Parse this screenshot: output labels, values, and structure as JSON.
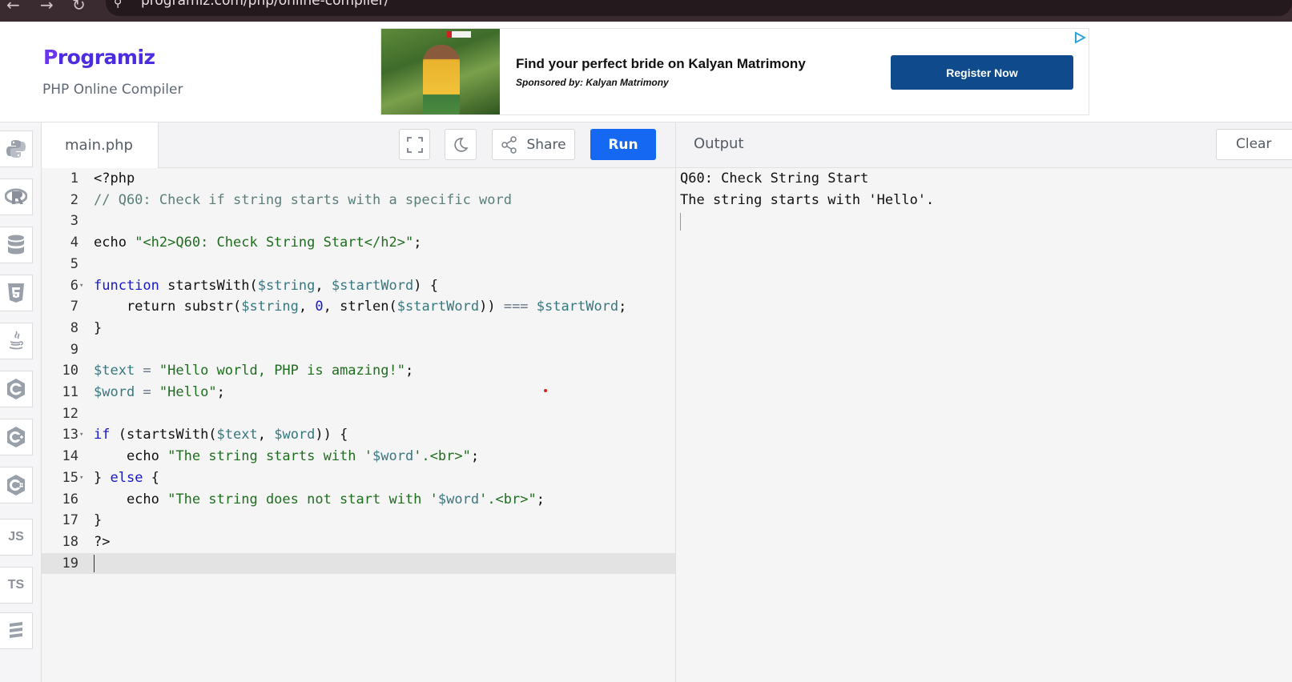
{
  "browser": {
    "url": "programiz.com/php/online-compiler/"
  },
  "header": {
    "logo_text": "rogramiz",
    "logo_mark": "P",
    "subtitle": "PHP Online Compiler"
  },
  "ad": {
    "title": "Find your perfect bride on Kalyan Matrimony",
    "sponsor": "Sponsored by: Kalyan Matrimony",
    "button_label": "Register Now",
    "button_color": "#0e4a8c"
  },
  "sidebar": {
    "languages": [
      {
        "name": "python-icon"
      },
      {
        "name": "r-icon"
      },
      {
        "name": "sql-icon"
      },
      {
        "name": "html5-icon"
      },
      {
        "name": "java-icon"
      },
      {
        "name": "c-icon"
      },
      {
        "name": "cpp-icon"
      },
      {
        "name": "csharp-icon"
      },
      {
        "name": "js-icon",
        "label": "JS"
      },
      {
        "name": "ts-icon",
        "label": "TS"
      },
      {
        "name": "go-icon"
      }
    ]
  },
  "editor": {
    "filename": "main.php",
    "share_label": "Share",
    "run_label": "Run",
    "run_color": "#1468f2",
    "active_line": 19,
    "line_numbers": [
      "1",
      "2",
      "3",
      "4",
      "5",
      "6",
      "7",
      "8",
      "9",
      "10",
      "11",
      "12",
      "13",
      "14",
      "15",
      "16",
      "17",
      "18",
      "19"
    ],
    "fold_lines": [
      6,
      13,
      15
    ]
  },
  "output": {
    "title": "Output",
    "clear_label": "Clear",
    "lines": [
      "Q60: Check String Start",
      "The string starts with 'Hello'."
    ]
  },
  "code": {
    "l1": "<?php",
    "l2": "// Q60: Check if string starts with a specific word",
    "l4_kw": "echo ",
    "l4_str": "\"<h2>Q60: Check String Start</h2>\"",
    "l4_end": ";",
    "l6_kw": "function",
    "l6_name": " startsWith(",
    "l6_v1": "$string",
    "l6_c": ", ",
    "l6_v2": "$startWord",
    "l6_end": ") {",
    "l7_a": "    return substr(",
    "l7_v1": "$string",
    "l7_c1": ", ",
    "l7_num": "0",
    "l7_c2": ", strlen(",
    "l7_v2": "$startWord",
    "l7_c3": ")) ",
    "l7_op": "===",
    "l7_sp": " ",
    "l7_v3": "$startWord",
    "l7_end": ";",
    "l8": "}",
    "l10_v": "$text",
    "l10_op": " = ",
    "l10_str": "\"Hello world, PHP is amazing!\"",
    "l10_end": ";",
    "l11_v": "$word",
    "l11_op": " = ",
    "l11_str": "\"Hello\"",
    "l11_end": ";",
    "l13_kw": "if",
    "l13_a": " (startsWith(",
    "l13_v1": "$text",
    "l13_c": ", ",
    "l13_v2": "$word",
    "l13_end": ")) {",
    "l14_a": "    echo ",
    "l14_s1": "\"The string starts with '",
    "l14_v": "$word",
    "l14_s2": "'.<br>\"",
    "l14_end": ";",
    "l15_a": "} ",
    "l15_kw": "else",
    "l15_end": " {",
    "l16_a": "    echo ",
    "l16_s1": "\"The string does not start with '",
    "l16_v": "$word",
    "l16_s2": "'.<br>\"",
    "l16_end": ";",
    "l17": "}",
    "l18": "?>"
  }
}
